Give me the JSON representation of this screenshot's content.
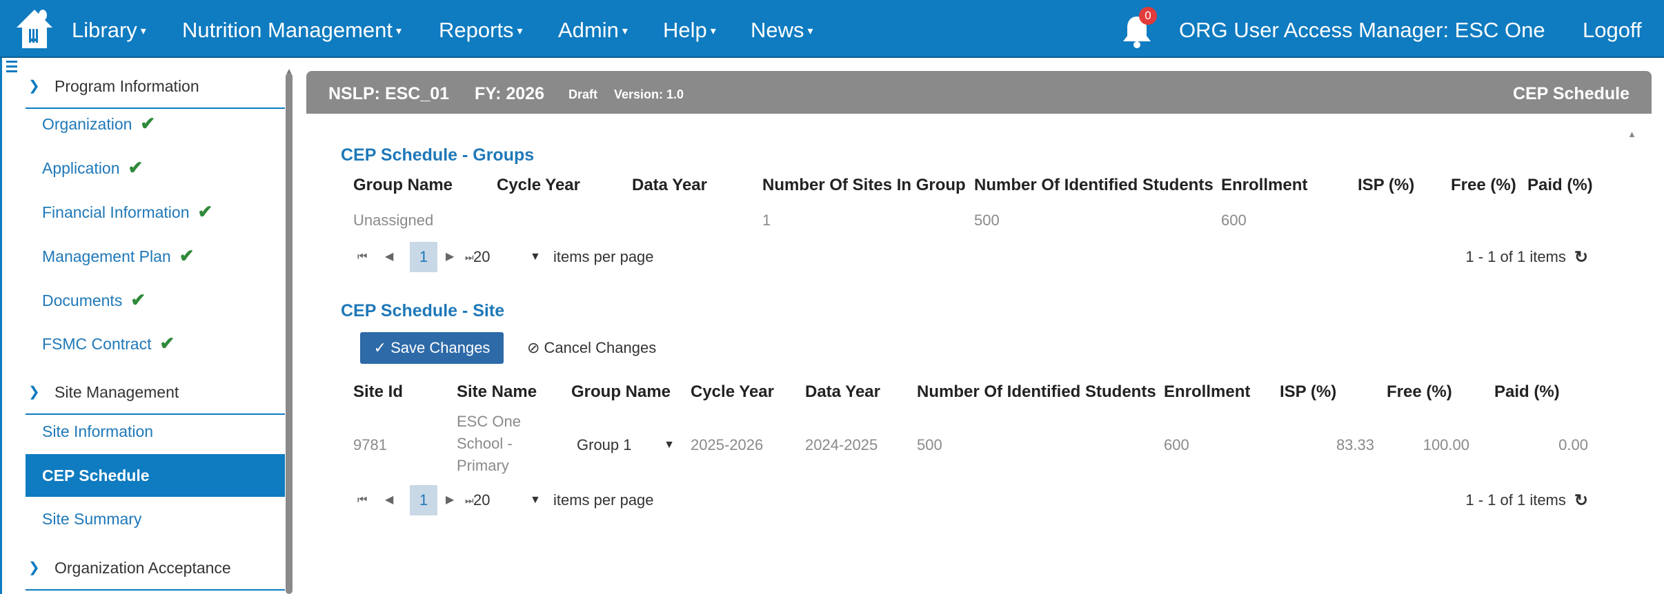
{
  "nav": {
    "items": [
      {
        "label": "Library"
      },
      {
        "label": "Nutrition Management"
      },
      {
        "label": "Reports"
      },
      {
        "label": "Admin"
      },
      {
        "label": "Help"
      },
      {
        "label": "News"
      }
    ],
    "notifications_count": "0",
    "user_label": "ORG User Access Manager: ESC One",
    "logoff_label": "Logoff"
  },
  "sidebar": {
    "section1": "Program Information",
    "items1": [
      {
        "label": "Organization"
      },
      {
        "label": "Application"
      },
      {
        "label": "Financial Information"
      },
      {
        "label": "Management Plan"
      },
      {
        "label": "Documents"
      },
      {
        "label": "FSMC Contract"
      }
    ],
    "section2": "Site Management",
    "items2": [
      {
        "label": "Site Information"
      },
      {
        "label": "CEP Schedule"
      },
      {
        "label": "Site Summary"
      }
    ],
    "section3": "Organization Acceptance"
  },
  "panel": {
    "program": "NSLP: ESC_01",
    "fy": "FY: 2026",
    "status": "Draft",
    "version": "Version: 1.0",
    "title": "CEP Schedule"
  },
  "groups": {
    "title": "CEP Schedule - Groups",
    "headers": [
      "Group Name",
      "Cycle Year",
      "Data Year",
      "Number Of Sites In Group",
      "Number Of Identified Students",
      "Enrollment",
      "ISP (%)",
      "Free (%)",
      "Paid (%)"
    ],
    "rows": [
      {
        "group_name": "Unassigned",
        "cycle_year": "",
        "data_year": "",
        "sites": "1",
        "identified": "500",
        "enrollment": "600",
        "isp": "",
        "free": "",
        "paid": ""
      }
    ],
    "pager": {
      "page": "1",
      "size": "20",
      "label": "items per page",
      "info": "1 - 1 of 1 items"
    }
  },
  "site": {
    "title": "CEP Schedule - Site",
    "save_label": "Save Changes",
    "cancel_label": "Cancel Changes",
    "headers": [
      "Site Id",
      "Site Name",
      "Group Name",
      "Cycle Year",
      "Data Year",
      "Number Of Identified Students",
      "Enrollment",
      "ISP (%)",
      "Free (%)",
      "Paid (%)"
    ],
    "rows": [
      {
        "site_id": "9781",
        "site_name_1": "ESC One",
        "site_name_2": "School -",
        "site_name_3": "Primary",
        "group_name": "Group 1",
        "cycle_year": "2025-2026",
        "data_year": "2024-2025",
        "identified": "500",
        "enrollment": "600",
        "isp": "83.33",
        "free": "100.00",
        "paid": "0.00"
      }
    ],
    "pager": {
      "page": "1",
      "size": "20",
      "label": "items per page",
      "info": "1 - 1 of 1 items"
    }
  }
}
